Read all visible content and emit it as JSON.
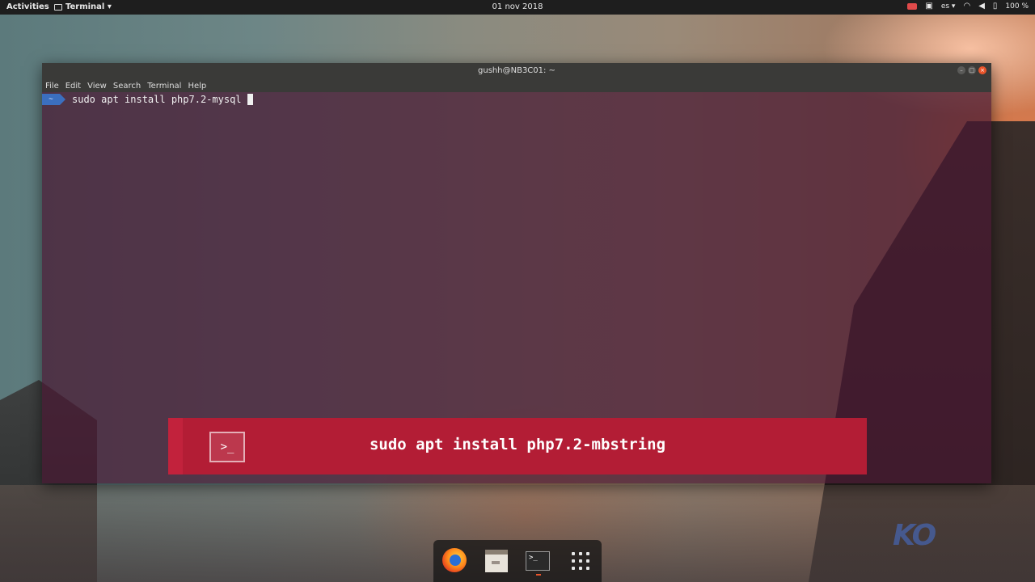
{
  "topbar": {
    "activities": "Activities",
    "app_menu": "Terminal ▾",
    "clock": "01 nov 2018",
    "language": "es ▾",
    "battery": "100 %",
    "icons": [
      "screen-record-icon",
      "clipboard-icon",
      "wifi-icon",
      "volume-icon",
      "battery-icon"
    ]
  },
  "window": {
    "title": "gushh@NB3C01: ~",
    "menu": [
      "File",
      "Edit",
      "View",
      "Search",
      "Terminal",
      "Help"
    ],
    "prompt_badge": "~",
    "command": "sudo apt install php7.2-mysql"
  },
  "banner": {
    "icon_glyph": ">_",
    "text": "sudo apt install php7.2-mbstring"
  },
  "dock": {
    "items": [
      "firefox-icon",
      "files-icon",
      "terminal-icon",
      "show-applications-icon"
    ],
    "terminal_glyph": ">_"
  },
  "colors": {
    "banner": "#b31d35",
    "prompt": "#3b6fbf",
    "close_button": "#e9542a"
  }
}
